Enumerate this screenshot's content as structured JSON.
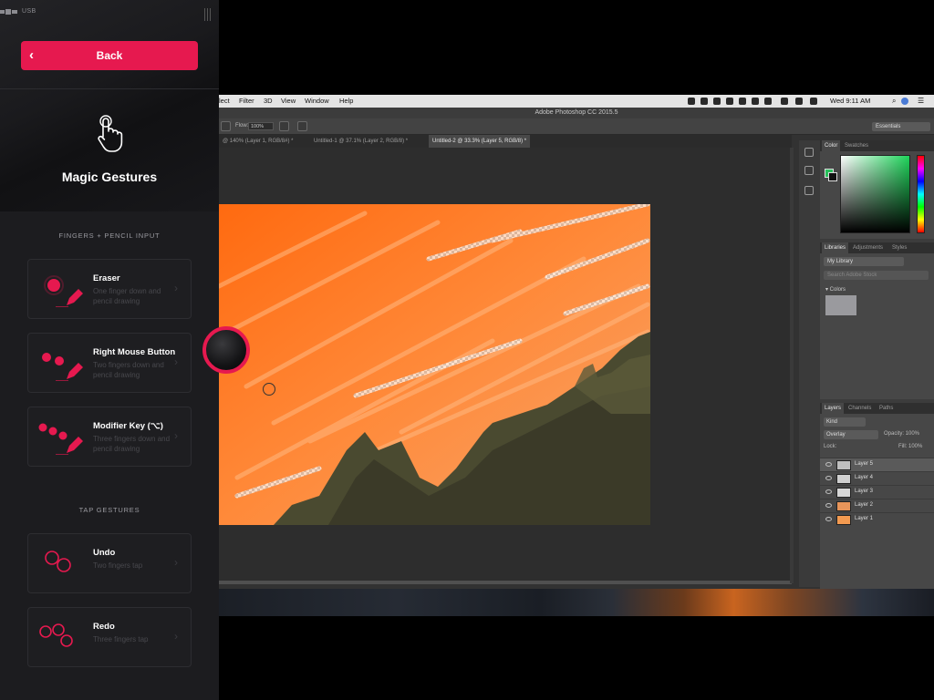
{
  "status_bar": {
    "connection": "USB"
  },
  "drawer": {
    "back_label": "Back",
    "title": "Magic Gestures",
    "sections": {
      "fingers_pencil": "FINGERS + PENCIL INPUT",
      "tap": "TAP GESTURES"
    },
    "gestures": [
      {
        "title": "Eraser",
        "desc": "One finger down and pencil drawing"
      },
      {
        "title": "Right Mouse Button",
        "desc": "Two fingers down and pencil drawing"
      },
      {
        "title": "Modifier Key (⌥)",
        "desc": "Three fingers down and pencil drawing"
      }
    ],
    "taps": [
      {
        "title": "Undo",
        "desc": "Two fingers tap"
      },
      {
        "title": "Redo",
        "desc": "Three fingers tap"
      }
    ],
    "accent_color": "#e6194f"
  },
  "mac_menu": {
    "items": [
      "lect",
      "Filter",
      "3D",
      "View",
      "Window",
      "Help"
    ],
    "clock": "Wed 9:11 AM"
  },
  "photoshop": {
    "title": "Adobe Photoshop CC 2015.5",
    "options": {
      "flow_label": "Flow:",
      "flow_value": "100%",
      "workspace": "Essentials"
    },
    "tabs": [
      "@ 140% (Layer 1, RGB/8#) *",
      "Untitled-1 @ 37.1% (Layer 2, RGB/8) *",
      "Untitled-2 @ 33.3% (Layer 5, RGB/8) *"
    ],
    "color_panel": {
      "tabs": [
        "Color",
        "Swatches"
      ],
      "foreground": "#28c05a",
      "background": "#111111"
    },
    "libraries_panel": {
      "tabs": [
        "Libraries",
        "Adjustments",
        "Styles"
      ],
      "library": "My Library",
      "search_placeholder": "Search Adobe Stock",
      "colors_label": "▾ Colors"
    },
    "layers_panel": {
      "tabs": [
        "Layers",
        "Channels",
        "Paths"
      ],
      "kind": "Kind",
      "blend_mode": "Overlay",
      "opacity": "Opacity: 100%",
      "lock": "Lock:",
      "fill": "Fill: 100%",
      "layers": [
        {
          "name": "Layer 5",
          "selected": true,
          "thumb": "#bfbfbf"
        },
        {
          "name": "Layer 4",
          "selected": false,
          "thumb": "#cfcfcf"
        },
        {
          "name": "Layer 3",
          "selected": false,
          "thumb": "#d6d6d6"
        },
        {
          "name": "Layer 2",
          "selected": false,
          "thumb": "#e8955a"
        },
        {
          "name": "Layer 1",
          "selected": false,
          "thumb": "#f39a50"
        }
      ]
    }
  }
}
